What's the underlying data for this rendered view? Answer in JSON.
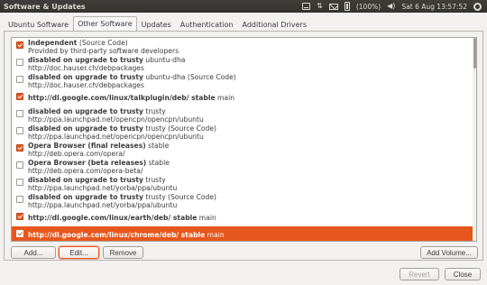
{
  "window": {
    "title": "Software & Updates"
  },
  "indicators": {
    "battery": "(100%)",
    "clock": "Sat 6 Aug 13:57:52"
  },
  "tabs": [
    {
      "label": "Ubuntu Software"
    },
    {
      "label": "Other Software"
    },
    {
      "label": "Updates"
    },
    {
      "label": "Authentication"
    },
    {
      "label": "Additional Drivers"
    }
  ],
  "sources": [
    {
      "checked": true,
      "title": "Independent",
      "suffix": " (Source Code)",
      "line2": "Provided by third-party software developers"
    },
    {
      "checked": false,
      "title": "disabled on upgrade to trusty",
      "suffix": " ubuntu-dha",
      "line2": "http://doc.hauser.ch/debpackages"
    },
    {
      "checked": false,
      "title": "disabled on upgrade to trusty",
      "suffix": " ubuntu-dha (Source Code)",
      "line2": "http://doc.hauser.ch/debpackages"
    },
    {
      "checked": true,
      "title": "http://dl.google.com/linux/talkplugin/deb/ stable",
      "suffix": " main",
      "line2": ""
    },
    {
      "checked": false,
      "title": "disabled on upgrade to trusty",
      "suffix": " trusty",
      "line2": "http://ppa.launchpad.net/opencpn/opencpn/ubuntu"
    },
    {
      "checked": false,
      "title": "disabled on upgrade to trusty",
      "suffix": " trusty (Source Code)",
      "line2": "http://ppa.launchpad.net/opencpn/opencpn/ubuntu"
    },
    {
      "checked": true,
      "title": "Opera Browser (final releases)",
      "suffix": " stable",
      "line2": "http://deb.opera.com/opera/"
    },
    {
      "checked": false,
      "title": "Opera Browser (beta releases)",
      "suffix": " stable",
      "line2": "http://deb.opera.com/opera-beta/"
    },
    {
      "checked": false,
      "title": "disabled on upgrade to trusty",
      "suffix": " trusty",
      "line2": "http://ppa.launchpad.net/yorba/ppa/ubuntu"
    },
    {
      "checked": false,
      "title": "disabled on upgrade to trusty",
      "suffix": " trusty (Source Code)",
      "line2": "http://ppa.launchpad.net/yorba/ppa/ubuntu"
    },
    {
      "checked": true,
      "title": "http://dl.google.com/linux/earth/deb/ stable",
      "suffix": " main",
      "line2": ""
    },
    {
      "checked": true,
      "title": "http://dl.google.com/linux/chrome/deb/ stable",
      "suffix": " main",
      "line2": "",
      "selected": true
    }
  ],
  "buttons": {
    "add": "Add...",
    "edit": "Edit...",
    "remove": "Remove",
    "add_volume": "Add Volume...",
    "revert": "Revert",
    "close": "Close"
  },
  "colors": {
    "accent": "#e5571c",
    "topbar": "#3c3b37"
  }
}
